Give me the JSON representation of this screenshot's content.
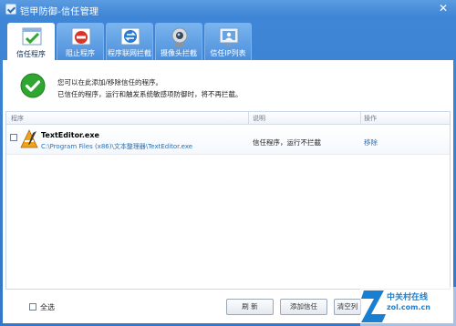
{
  "window": {
    "title": "铠甲防御-信任管理"
  },
  "tabs": [
    {
      "label": "信任程序",
      "icon": "trusted-program-icon",
      "active": true
    },
    {
      "label": "阻止程序",
      "icon": "block-icon",
      "active": false
    },
    {
      "label": "程序联网拦截",
      "icon": "network-block-icon",
      "active": false
    },
    {
      "label": "摄像头拦截",
      "icon": "webcam-icon",
      "active": false
    },
    {
      "label": "信任IP列表",
      "icon": "ip-list-icon",
      "active": false
    }
  ],
  "info": {
    "line1": "您可以在此添加/移除信任的程序。",
    "line2": "已信任的程序，运行和触发系统敏感项防御时，将不再拦截。"
  },
  "table": {
    "columns": [
      "程序",
      "说明",
      "操作"
    ],
    "rows": [
      {
        "name": "TextEditor.exe",
        "path": "C:\\Program Files (x86)\\文本整理器\\TextEditor.exe",
        "description": "信任程序，运行不拦截",
        "action": "移除"
      }
    ]
  },
  "footer": {
    "select_all_label": "全选",
    "refresh_label": "刷 新",
    "add_trust_label": "添加信任",
    "clear_label": "清空列"
  },
  "watermark": {
    "line1": "中关村在线",
    "line2": "zol.com.cn"
  },
  "colors": {
    "frame": "#3f86d6",
    "link": "#2e6fb0",
    "check_green": "#2fa62f"
  }
}
